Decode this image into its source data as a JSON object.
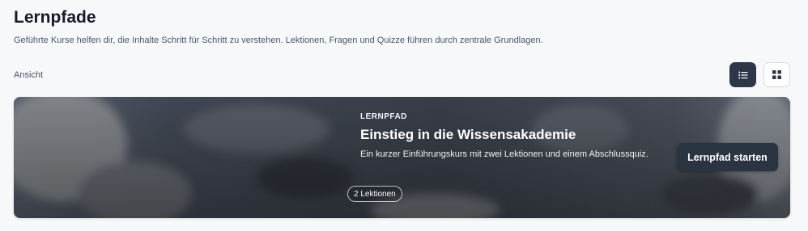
{
  "header": {
    "title": "Lernpfade",
    "subtitle": "Geführte Kurse helfen dir, die Inhalte Schritt für Schritt zu verstehen. Lektionen, Fragen und Quizze führen durch zentrale Grundlagen."
  },
  "view": {
    "label": "Ansicht",
    "options": [
      {
        "icon": "list-icon",
        "active": true
      },
      {
        "icon": "grid-icon",
        "active": false
      }
    ]
  },
  "card": {
    "eyebrow": "LERNPFAD",
    "title": "Einstieg in die Wissensakademie",
    "description": "Ein kurzer Einführungskurs mit zwei Lektionen und einem Abschlussquiz.",
    "cta_label": "Lernpfad starten",
    "badge": "2 Lektionen"
  },
  "colors": {
    "accent": "#2d3748",
    "background": "#f7f8fa"
  }
}
